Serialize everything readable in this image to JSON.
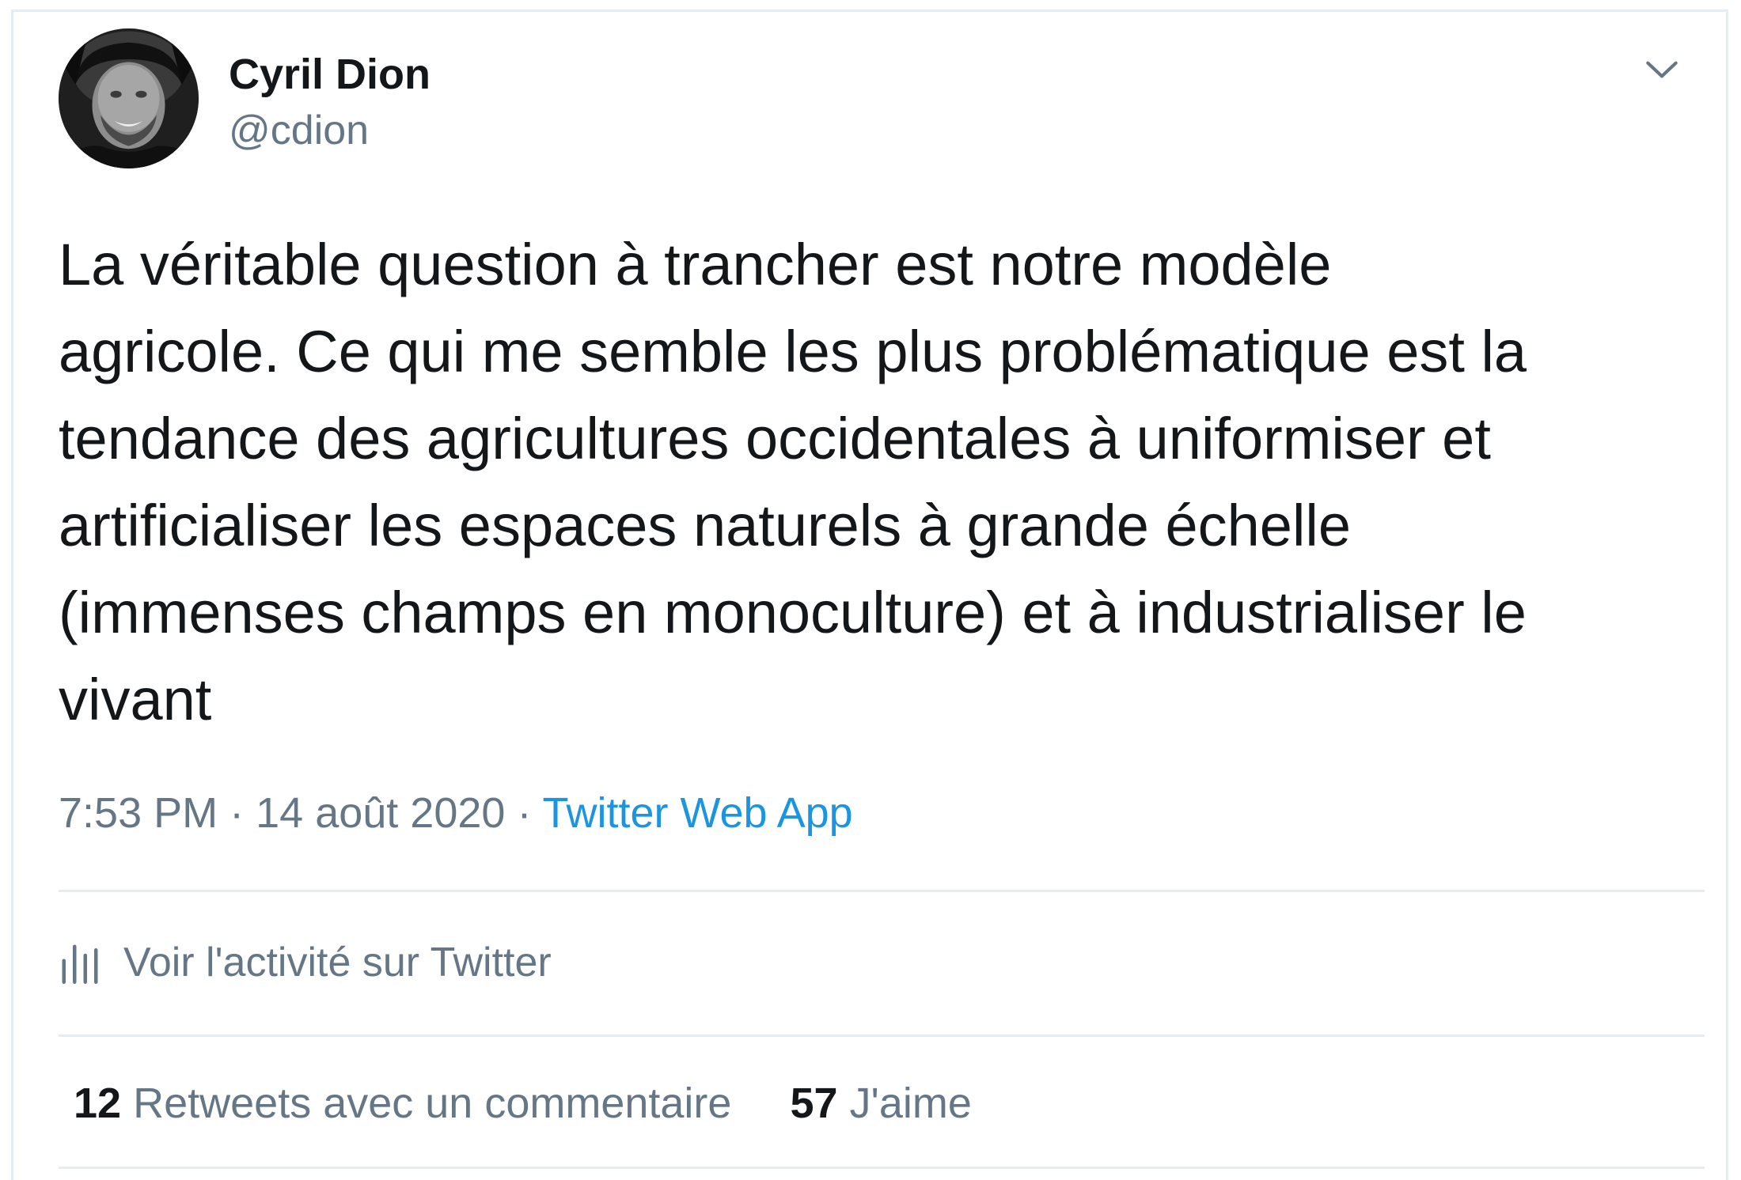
{
  "author": {
    "display_name": "Cyril Dion",
    "handle": "@cdion"
  },
  "tweet": {
    "lines": [
      "La véritable question à trancher est notre modèle",
      "agricole. Ce qui me semble les plus problématique est la",
      "tendance des agricultures occidentales à uniformiser et",
      "artificialiser les espaces naturels à grande échelle",
      "(immenses champs en monoculture) et à industrialiser le",
      "vivant"
    ],
    "time": "7:53 PM",
    "separator": "·",
    "date": "14 août 2020",
    "source": "Twitter Web App"
  },
  "activity": {
    "label": "Voir l'activité sur Twitter",
    "icon": "analytics-bars-icon"
  },
  "stats": {
    "retweets_count": "12",
    "retweets_label": "Retweets avec un commentaire",
    "likes_count": "57",
    "likes_label": "J'aime"
  },
  "icons": {
    "menu": "chevron-down-icon"
  },
  "colors": {
    "text": "#14171a",
    "secondary": "#657786",
    "link": "#1b95e0",
    "border": "#e6ecf0"
  }
}
